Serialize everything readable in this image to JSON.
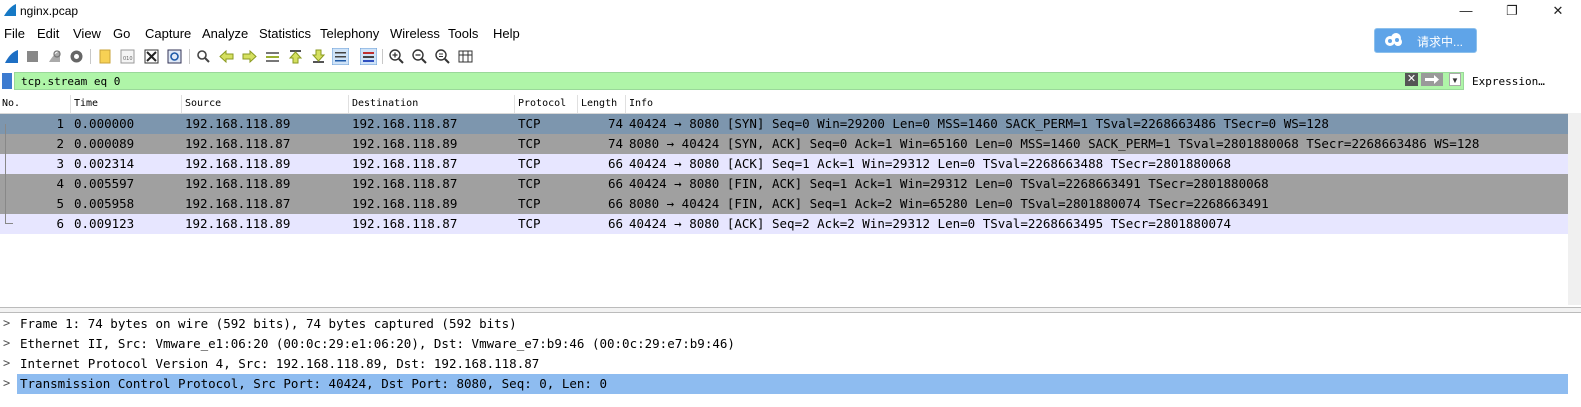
{
  "window": {
    "title": "nginx.pcap",
    "minimize": "—",
    "restore": "❐",
    "close": "✕"
  },
  "menu": [
    "File",
    "Edit",
    "View",
    "Go",
    "Capture",
    "Analyze",
    "Statistics",
    "Telephony",
    "Wireless",
    "Tools",
    "Help"
  ],
  "toolbar_icons": [
    "shark-fin-start-icon",
    "stop-icon",
    "restart-icon",
    "options-gear-icon",
    "open-folder-icon",
    "save-file-icon",
    "close-file-icon",
    "reload-icon",
    "find-icon",
    "back-arrow-icon",
    "forward-arrow-icon",
    "go-to-packet-icon",
    "first-packet-icon",
    "last-packet-icon",
    "autoscroll-icon",
    "colorize-icon",
    "zoom-in-icon",
    "zoom-out-icon",
    "zoom-normal-icon",
    "resize-columns-icon"
  ],
  "baidu": {
    "label": "请求中..."
  },
  "filter": {
    "value": "tcp.stream eq 0",
    "expression_label": "Expression…"
  },
  "columns": [
    "No.",
    "Time",
    "Source",
    "Destination",
    "Protocol",
    "Length",
    "Info"
  ],
  "packets": [
    {
      "no": "1",
      "time": "0.000000",
      "src": "192.168.118.89",
      "dst": "192.168.118.87",
      "proto": "TCP",
      "len": "74",
      "info": "40424 → 8080 [SYN] Seq=0 Win=29200 Len=0 MSS=1460 SACK_PERM=1 TSval=2268663486 TSecr=0 WS=128",
      "bg": "#7d96ae",
      "selected": true
    },
    {
      "no": "2",
      "time": "0.000089",
      "src": "192.168.118.87",
      "dst": "192.168.118.89",
      "proto": "TCP",
      "len": "74",
      "info": "8080 → 40424 [SYN, ACK] Seq=0 Ack=1 Win=65160 Len=0 MSS=1460 SACK_PERM=1 TSval=2801880068 TSecr=2268663486 WS=128",
      "bg": "#a0a0a0",
      "selected": false
    },
    {
      "no": "3",
      "time": "0.002314",
      "src": "192.168.118.89",
      "dst": "192.168.118.87",
      "proto": "TCP",
      "len": "66",
      "info": "40424 → 8080 [ACK] Seq=1 Ack=1 Win=29312 Len=0 TSval=2268663488 TSecr=2801880068",
      "bg": "#e7e6ff",
      "selected": false
    },
    {
      "no": "4",
      "time": "0.005597",
      "src": "192.168.118.89",
      "dst": "192.168.118.87",
      "proto": "TCP",
      "len": "66",
      "info": "40424 → 8080 [FIN, ACK] Seq=1 Ack=1 Win=29312 Len=0 TSval=2268663491 TSecr=2801880068",
      "bg": "#a0a0a0",
      "selected": false
    },
    {
      "no": "5",
      "time": "0.005958",
      "src": "192.168.118.87",
      "dst": "192.168.118.89",
      "proto": "TCP",
      "len": "66",
      "info": "8080 → 40424 [FIN, ACK] Seq=1 Ack=2 Win=65280 Len=0 TSval=2801880074 TSecr=2268663491",
      "bg": "#a0a0a0",
      "selected": false
    },
    {
      "no": "6",
      "time": "0.009123",
      "src": "192.168.118.89",
      "dst": "192.168.118.87",
      "proto": "TCP",
      "len": "66",
      "info": "40424 → 8080 [ACK] Seq=2 Ack=2 Win=29312 Len=0 TSval=2268663495 TSecr=2801880074",
      "bg": "#e7e6ff",
      "selected": false
    }
  ],
  "details": [
    {
      "arrow": ">",
      "text": "Frame 1: 74 bytes on wire (592 bits), 74 bytes captured (592 bits)",
      "selected": false
    },
    {
      "arrow": ">",
      "text": "Ethernet II, Src: Vmware_e1:06:20 (00:0c:29:e1:06:20), Dst: Vmware_e7:b9:46 (00:0c:29:e7:b9:46)",
      "selected": false
    },
    {
      "arrow": ">",
      "text": "Internet Protocol Version 4, Src: 192.168.118.89, Dst: 192.168.118.87",
      "selected": false
    },
    {
      "arrow": ">",
      "text": "Transmission Control Protocol, Src Port: 40424, Dst Port: 8080, Seq: 0, Len: 0",
      "selected": true
    }
  ]
}
